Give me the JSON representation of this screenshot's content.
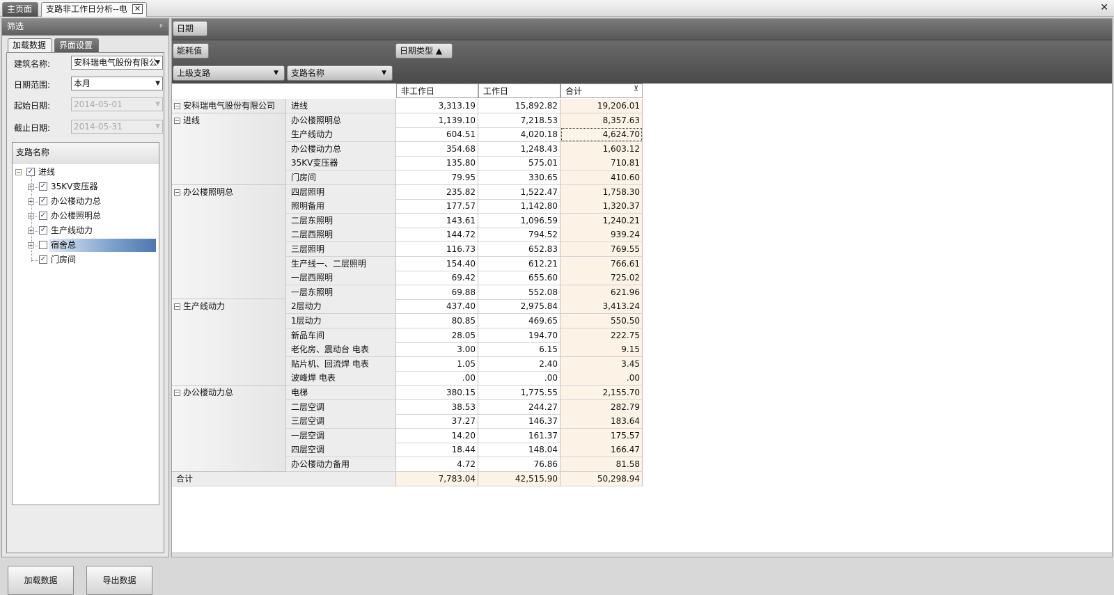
{
  "tabs": {
    "home": "主页面",
    "branch": "支路非工作日分析--电",
    "close": "✕"
  },
  "window_close": "✕",
  "filter": {
    "title": "筛选",
    "pin": "ᵖ",
    "tab_load": "加载数据",
    "tab_ui": "界面设置",
    "building_label": "建筑名称:",
    "building_value": "安科瑞电气股份有限公",
    "range_label": "日期范围:",
    "range_value": "本月",
    "start_label": "起始日期:",
    "start_value": "2014-05-01",
    "end_label": "截止日期:",
    "end_value": "2014-05-31",
    "tree_header": "支路名称",
    "tree": {
      "root": "进线",
      "items": [
        "35KV变压器",
        "办公楼动力总",
        "办公楼照明总",
        "生产线动力",
        "宿舍总",
        "门房间"
      ]
    },
    "load_button": "加载数据",
    "export_button": "导出数据"
  },
  "pivot": {
    "filter_field": "日期",
    "data_field": "能耗值",
    "col_field": "日期类型",
    "col_sort": "▲",
    "row_field_1": "上级支路",
    "row_field_2": "支路名称",
    "columns": [
      "非工作日",
      "工作日",
      "合计"
    ],
    "groups": [
      {
        "parent": "安科瑞电气股份有限公司",
        "rows": [
          {
            "name": "进线",
            "v": [
              "3,313.19",
              "15,892.82",
              "19,206.01"
            ]
          }
        ]
      },
      {
        "parent": "进线",
        "rows": [
          {
            "name": "办公楼照明总",
            "v": [
              "1,139.10",
              "7,218.53",
              "8,357.63"
            ]
          },
          {
            "name": "生产线动力",
            "v": [
              "604.51",
              "4,020.18",
              "4,624.70"
            ]
          },
          {
            "name": "办公楼动力总",
            "v": [
              "354.68",
              "1,248.43",
              "1,603.12"
            ]
          },
          {
            "name": "35KV变压器",
            "v": [
              "135.80",
              "575.01",
              "710.81"
            ]
          },
          {
            "name": "门房间",
            "v": [
              "79.95",
              "330.65",
              "410.60"
            ]
          }
        ]
      },
      {
        "parent": "办公楼照明总",
        "rows": [
          {
            "name": "四层照明",
            "v": [
              "235.82",
              "1,522.47",
              "1,758.30"
            ]
          },
          {
            "name": "照明备用",
            "v": [
              "177.57",
              "1,142.80",
              "1,320.37"
            ]
          },
          {
            "name": "二层东照明",
            "v": [
              "143.61",
              "1,096.59",
              "1,240.21"
            ]
          },
          {
            "name": "二层西照明",
            "v": [
              "144.72",
              "794.52",
              "939.24"
            ]
          },
          {
            "name": "三层照明",
            "v": [
              "116.73",
              "652.83",
              "769.55"
            ]
          },
          {
            "name": "生产线一、二层照明",
            "v": [
              "154.40",
              "612.21",
              "766.61"
            ]
          },
          {
            "name": "一层西照明",
            "v": [
              "69.42",
              "655.60",
              "725.02"
            ]
          },
          {
            "name": "一层东照明",
            "v": [
              "69.88",
              "552.08",
              "621.96"
            ]
          }
        ]
      },
      {
        "parent": "生产线动力",
        "rows": [
          {
            "name": "2层动力",
            "v": [
              "437.40",
              "2,975.84",
              "3,413.24"
            ]
          },
          {
            "name": "1层动力",
            "v": [
              "80.85",
              "469.65",
              "550.50"
            ]
          },
          {
            "name": "新品车间",
            "v": [
              "28.05",
              "194.70",
              "222.75"
            ]
          },
          {
            "name": "老化房、震动台 电表",
            "v": [
              "3.00",
              "6.15",
              "9.15"
            ]
          },
          {
            "name": "贴片机、回流焊 电表",
            "v": [
              "1.05",
              "2.40",
              "3.45"
            ]
          },
          {
            "name": "波峰焊 电表",
            "v": [
              ".00",
              ".00",
              ".00"
            ]
          }
        ]
      },
      {
        "parent": "办公楼动力总",
        "rows": [
          {
            "name": "电梯",
            "v": [
              "380.15",
              "1,775.55",
              "2,155.70"
            ]
          },
          {
            "name": "二层空调",
            "v": [
              "38.53",
              "244.27",
              "282.79"
            ]
          },
          {
            "name": "三层空调",
            "v": [
              "37.27",
              "146.37",
              "183.64"
            ]
          },
          {
            "name": "一层空调",
            "v": [
              "14.20",
              "161.37",
              "175.57"
            ]
          },
          {
            "name": "四层空调",
            "v": [
              "18.44",
              "148.04",
              "166.47"
            ]
          },
          {
            "name": "办公楼动力备用",
            "v": [
              "4.72",
              "76.86",
              "81.58"
            ]
          }
        ]
      }
    ],
    "total_label": "合计",
    "totals": [
      "7,783.04",
      "42,515.90",
      "50,298.94"
    ]
  }
}
